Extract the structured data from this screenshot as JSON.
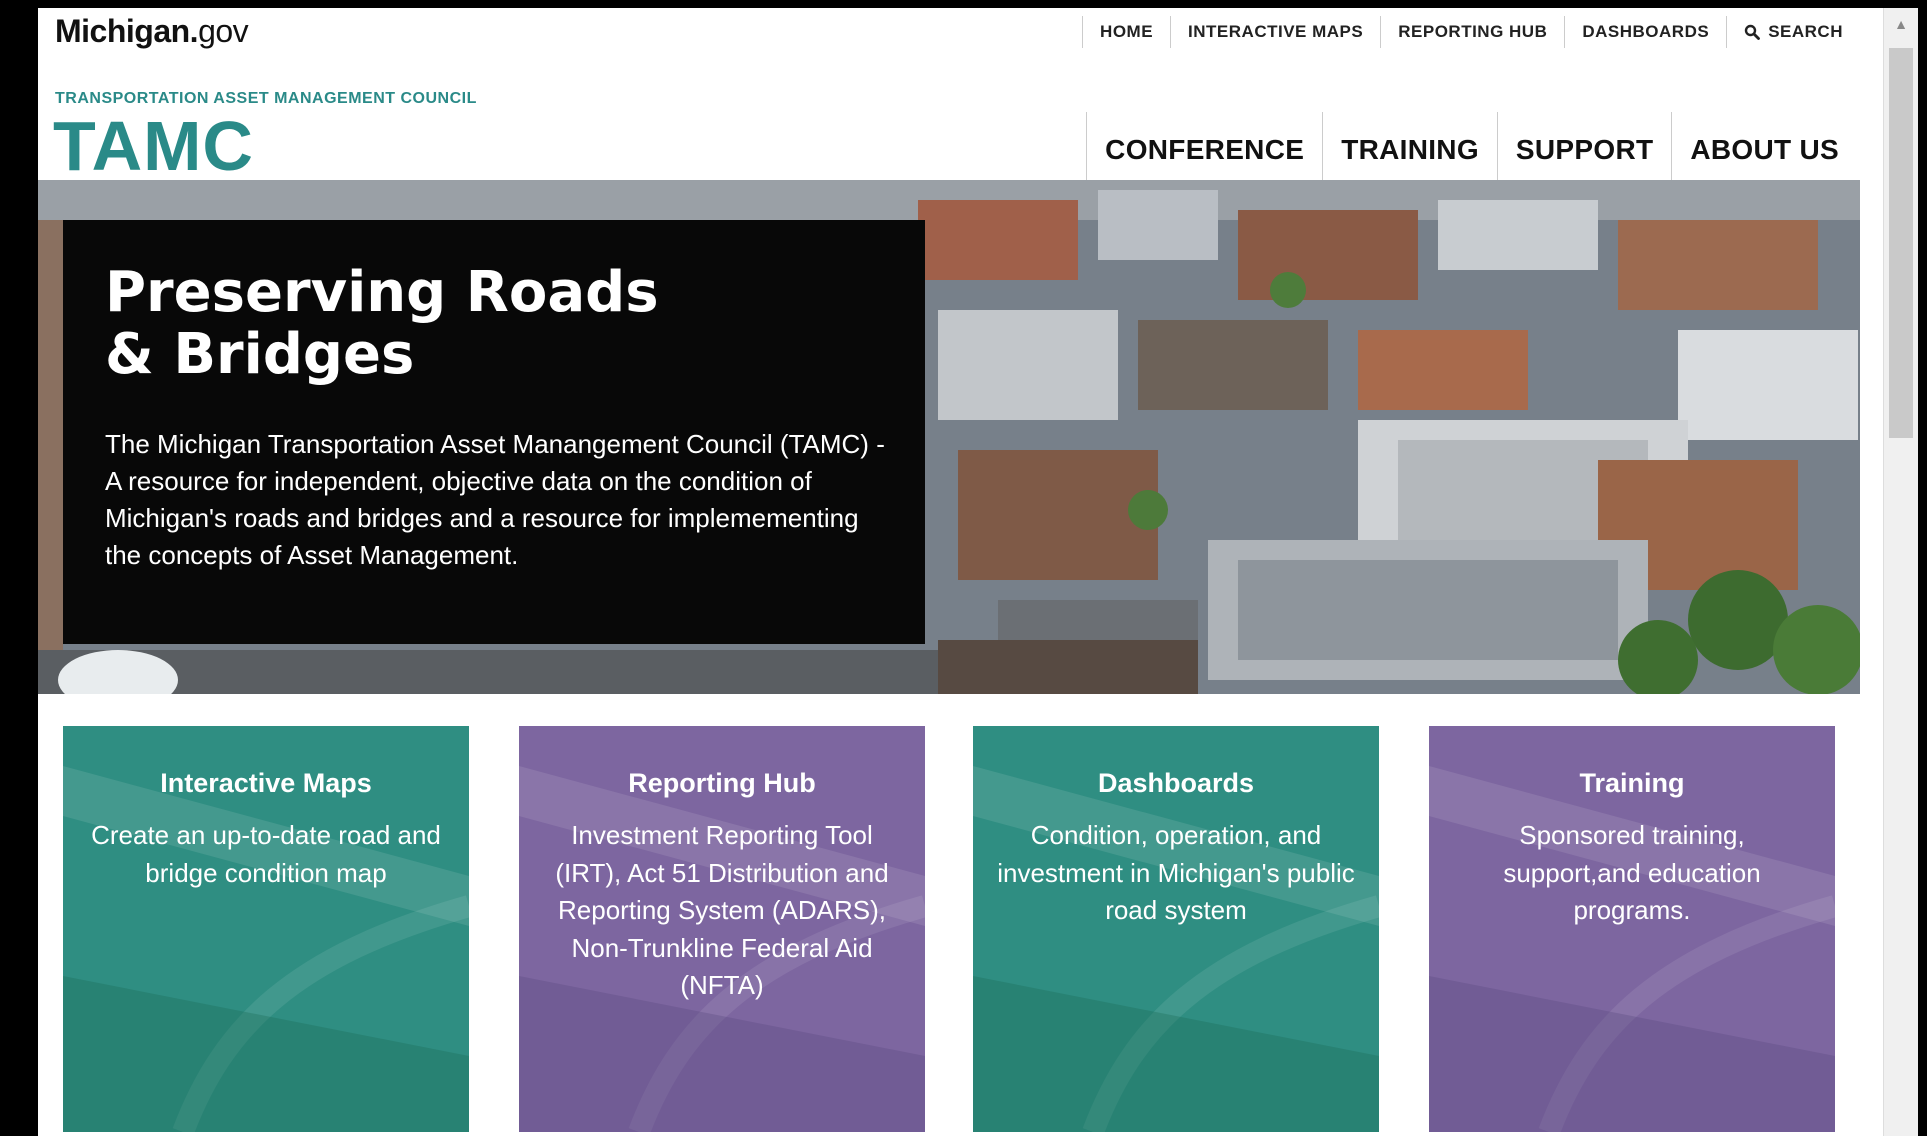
{
  "util_nav": {
    "logo_bold": "Michigan.",
    "logo_light": "gov",
    "items": [
      "HOME",
      "INTERACTIVE MAPS",
      "REPORTING HUB",
      "DASHBOARDS"
    ],
    "search_label": "SEARCH"
  },
  "header": {
    "council_name": "TRANSPORTATION ASSET MANAGEMENT COUNCIL",
    "acronym": "TAMC",
    "nav": [
      "CONFERENCE",
      "TRAINING",
      "SUPPORT",
      "ABOUT US"
    ]
  },
  "hero": {
    "title": "Preserving Roads & Bridges",
    "text": "The Michigan Transportation Asset Manangement Council (TAMC) - A  resource for independent, objective data on the condition of Michigan's roads and bridges and a resource for implemementing the concepts of Asset Management."
  },
  "cards": [
    {
      "title": "Interactive Maps",
      "desc": "Create an up-to-date road and bridge condition map",
      "color": "#2f8e82"
    },
    {
      "title": "Reporting Hub",
      "desc": "Investment Reporting Tool (IRT), Act 51 Distribution and Reporting System (ADARS), Non-Trunkline Federal Aid (NFTA)",
      "color": "#7d66a0"
    },
    {
      "title": "Dashboards",
      "desc": "Condition, operation, and investment in Michigan's public road system",
      "color": "#2f8e82"
    },
    {
      "title": "Training",
      "desc": "Sponsored training, support,and education programs.",
      "color": "#7d66a0"
    }
  ],
  "colors": {
    "accent": "#2a8a88",
    "teal_card": "#2f8e82",
    "purple_card": "#7d66a0"
  },
  "icons": {
    "search": "search-icon",
    "scroll_up": "scroll-up-arrow-icon"
  }
}
